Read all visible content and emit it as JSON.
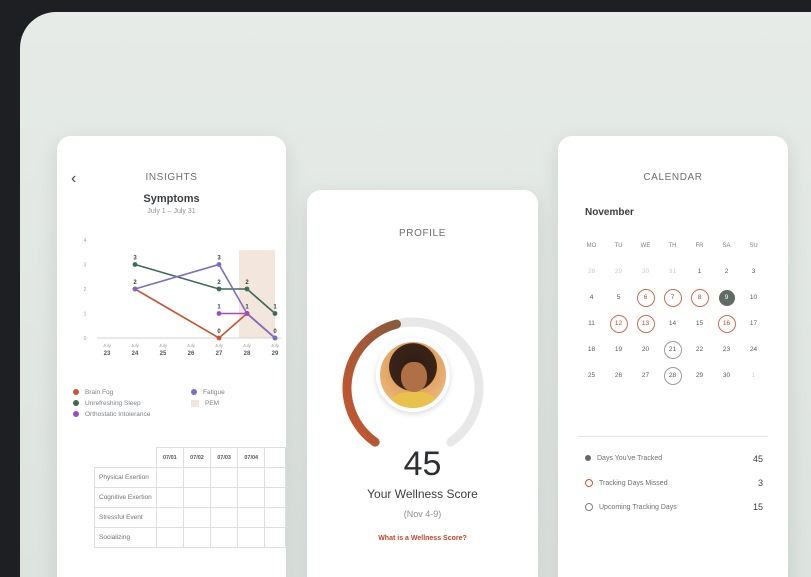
{
  "insights": {
    "title": "INSIGHTS",
    "back": "‹",
    "subtitle": "Symptoms",
    "date_range": "July 1 – July 31",
    "legend": [
      {
        "label": "Brain Fog",
        "color": "#c9562f",
        "shape": "dot"
      },
      {
        "label": "Fatigue",
        "color": "#7b6cc8",
        "shape": "dot"
      },
      {
        "label": "Unrefreshing Sleep",
        "color": "#3f6a5a",
        "shape": "dot"
      },
      {
        "label": "PEM",
        "color": "#f1e6dc",
        "shape": "square"
      },
      {
        "label": "Orthostatic Intolerance",
        "color": "#9b4ec2",
        "shape": "dot"
      }
    ],
    "activity_table": {
      "columns": [
        "07/01",
        "07/02",
        "07/03",
        "07/04"
      ],
      "rows": [
        "Physical Exertion",
        "Cognitive Exertion",
        "Stressful Event",
        "Socializing"
      ]
    }
  },
  "chart_data": {
    "type": "line",
    "x": [
      "July 23",
      "July 24",
      "July 25",
      "July 26",
      "July 27",
      "July 28",
      "July 29"
    ],
    "tick_labels": [
      [
        "July",
        "23"
      ],
      [
        "July",
        "24"
      ],
      [
        "July",
        "25"
      ],
      [
        "July",
        "26"
      ],
      [
        "July",
        "27"
      ],
      [
        "July",
        "28"
      ],
      [
        "July",
        "29"
      ]
    ],
    "ylim": [
      0,
      4
    ],
    "yticks": [
      "0",
      "1",
      "2",
      "3",
      "4"
    ],
    "highlight_band": {
      "from": "July 28",
      "to": "July 29",
      "series": "PEM"
    },
    "series": [
      {
        "name": "Brain Fog",
        "color": "#c9562f",
        "points": [
          [
            1,
            2
          ],
          [
            4,
            0
          ],
          [
            5,
            1
          ],
          [
            6,
            0
          ]
        ]
      },
      {
        "name": "Unrefreshing Sleep",
        "color": "#3f6a5a",
        "points": [
          [
            1,
            3
          ],
          [
            4,
            2
          ],
          [
            5,
            2
          ],
          [
            6,
            1
          ]
        ]
      },
      {
        "name": "Fatigue",
        "color": "#7b6cc8",
        "points": [
          [
            1,
            2
          ],
          [
            4,
            3
          ],
          [
            5,
            1
          ],
          [
            6,
            0
          ]
        ]
      },
      {
        "name": "Orthostatic Intolerance",
        "color": "#9b4ec2",
        "points": [
          [
            4,
            1
          ],
          [
            5,
            1
          ]
        ]
      }
    ],
    "data_labels": [
      {
        "x": 1,
        "y": 3,
        "text": "3"
      },
      {
        "x": 1,
        "y": 2,
        "text": "2"
      },
      {
        "x": 4,
        "y": 3,
        "text": "3"
      },
      {
        "x": 4,
        "y": 2,
        "text": "2"
      },
      {
        "x": 4,
        "y": 1,
        "text": "1"
      },
      {
        "x": 4,
        "y": 0,
        "text": "0"
      },
      {
        "x": 5,
        "y": 2,
        "text": "2"
      },
      {
        "x": 5,
        "y": 1,
        "text": "1"
      },
      {
        "x": 6,
        "y": 1,
        "text": "1"
      },
      {
        "x": 6,
        "y": 0,
        "text": "0"
      }
    ]
  },
  "profile": {
    "title": "PROFILE",
    "score": "45",
    "score_fraction": 0.45,
    "score_label": "Your Wellness Score",
    "score_date": "(Nov 4-9)",
    "link": "What is a Wellness Score?",
    "colors": {
      "start": "#c9562f",
      "end": "#8a5a3a",
      "track": "#e8e8e8"
    }
  },
  "calendar": {
    "title": "CALENDAR",
    "month": "November",
    "weekdays": [
      "MO",
      "TU",
      "WE",
      "TH",
      "FR",
      "SA",
      "SU"
    ],
    "weeks": [
      [
        {
          "d": "28",
          "s": "faded"
        },
        {
          "d": "29",
          "s": "faded"
        },
        {
          "d": "30",
          "s": "faded"
        },
        {
          "d": "31",
          "s": "faded"
        },
        {
          "d": "1",
          "s": ""
        },
        {
          "d": "2",
          "s": ""
        },
        {
          "d": "3",
          "s": ""
        }
      ],
      [
        {
          "d": "4",
          "s": ""
        },
        {
          "d": "5",
          "s": ""
        },
        {
          "d": "6",
          "s": "missed"
        },
        {
          "d": "7",
          "s": "missed"
        },
        {
          "d": "8",
          "s": "missed"
        },
        {
          "d": "9",
          "s": "tracked"
        },
        {
          "d": "10",
          "s": ""
        }
      ],
      [
        {
          "d": "11",
          "s": ""
        },
        {
          "d": "12",
          "s": "missed"
        },
        {
          "d": "13",
          "s": "missed"
        },
        {
          "d": "14",
          "s": ""
        },
        {
          "d": "15",
          "s": ""
        },
        {
          "d": "16",
          "s": "missed"
        },
        {
          "d": "17",
          "s": ""
        }
      ],
      [
        {
          "d": "18",
          "s": ""
        },
        {
          "d": "19",
          "s": ""
        },
        {
          "d": "20",
          "s": ""
        },
        {
          "d": "21",
          "s": "upcoming"
        },
        {
          "d": "22",
          "s": ""
        },
        {
          "d": "23",
          "s": ""
        },
        {
          "d": "24",
          "s": ""
        }
      ],
      [
        {
          "d": "25",
          "s": ""
        },
        {
          "d": "26",
          "s": ""
        },
        {
          "d": "27",
          "s": ""
        },
        {
          "d": "28",
          "s": "upcoming"
        },
        {
          "d": "29",
          "s": ""
        },
        {
          "d": "30",
          "s": ""
        },
        {
          "d": "1",
          "s": "faded"
        }
      ]
    ],
    "stats": [
      {
        "label": "Days You've Tracked",
        "value": "45",
        "marker": "filled",
        "color": "#5f6b63"
      },
      {
        "label": "Tracking Days Missed",
        "value": "3",
        "marker": "ring",
        "color": "#c9562f"
      },
      {
        "label": "Upcoming Tracking Days",
        "value": "15",
        "marker": "ring",
        "color": "#7d8186"
      }
    ]
  }
}
